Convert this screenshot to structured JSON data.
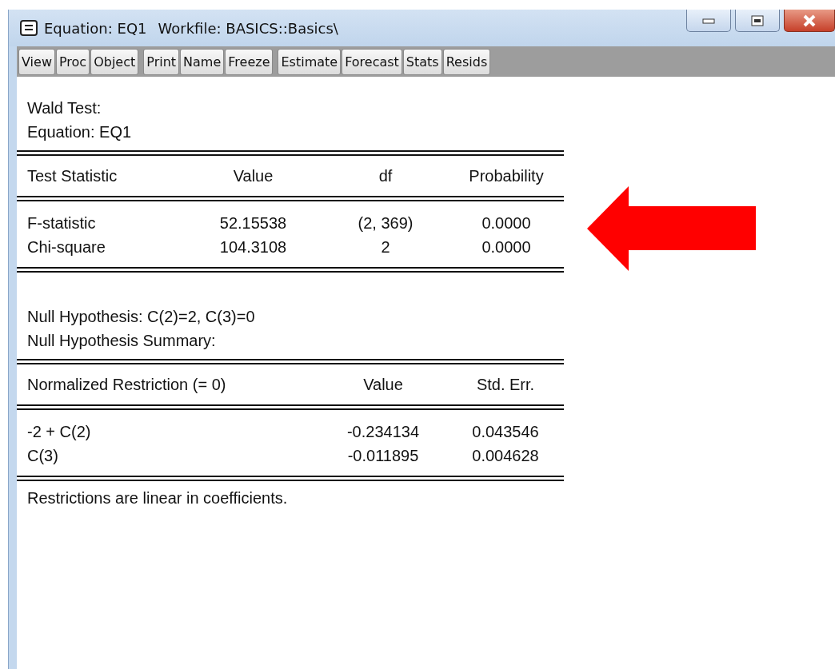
{
  "window": {
    "title": "Equation: EQ1",
    "subtitle": "Workfile: BASICS::Basics\\"
  },
  "toolbar": [
    {
      "buttons": [
        "View",
        "Proc",
        "Object"
      ]
    },
    {
      "buttons": [
        "Print",
        "Name",
        "Freeze"
      ]
    },
    {
      "buttons": [
        "Estimate",
        "Forecast",
        "Stats",
        "Resids"
      ]
    }
  ],
  "report": {
    "heading": [
      "Wald Test:",
      "Equation: EQ1"
    ],
    "test_table": {
      "columns": [
        "Test Statistic",
        "Value",
        "df",
        "Probability"
      ],
      "rows": [
        [
          "F-statistic",
          "52.15538",
          "(2, 369)",
          "0.0000"
        ],
        [
          "Chi-square",
          "104.3108",
          "2",
          "0.0000"
        ]
      ]
    },
    "hypothesis": [
      "Null Hypothesis: C(2)=2, C(3)=0",
      "Null Hypothesis Summary:"
    ],
    "restriction_table": {
      "columns": [
        "Normalized Restriction (= 0)",
        "Value",
        "Std. Err."
      ],
      "rows": [
        [
          "-2 + C(2)",
          "-0.234134",
          "0.043546"
        ],
        [
          "C(3)",
          "-0.011895",
          "0.004628"
        ]
      ]
    },
    "note": "Restrictions are linear in coefficients."
  }
}
